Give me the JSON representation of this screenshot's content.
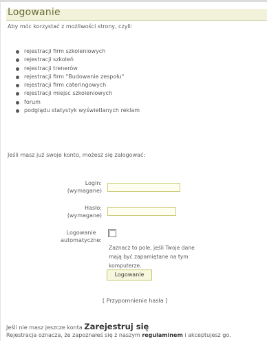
{
  "header": {
    "title": "Logowanie"
  },
  "intro_text": "Aby móc korzystać z możliwości strony, czyli:",
  "features": [
    "rejestracji firm szkoleniowych",
    "rejestracji szkoleń",
    "rejestracji trenerów",
    "rejestracji firm \"Budowanie zespołu\"",
    "rejestracji firm cateringowych",
    "rejestracji miejsc szkoleniowych",
    "forum",
    "podglądu statystyk wyświetlanych reklam"
  ],
  "login_prompt": "Jeśli masz już swoje konto, możesz się zalogować:",
  "form": {
    "login_label": "Login:",
    "login_required": "(wymagane)",
    "login_value": "",
    "password_label": "Hasło:",
    "password_required": "(wymagane)",
    "password_value": "",
    "auto_login_label_line1": "Logowanie",
    "auto_login_label_line2": "automatyczne:",
    "auto_login_hint": "Zaznacz to pole, jeśli Twoje dane mają być zapamiętane na tym komputerze.",
    "submit_label": "Logowanie"
  },
  "password_reminder": {
    "open_bracket": "[ ",
    "link": "Przypomnienie hasła",
    "close_bracket": " ]"
  },
  "register": {
    "prefix": "Jeśli nie masz jeszcze konta ",
    "link": "Zarejestruj się",
    "terms_prefix": "Rejestracja oznacza, że zapoznałeś się z naszym ",
    "terms_link": "regulaminem",
    "terms_suffix": " i akceptujesz go."
  },
  "icons": {
    "bullet": "bullet-icon",
    "checkbox": "checkbox-icon"
  },
  "colors": {
    "title_bar": "#f1f2d9",
    "title_text": "#6b6b3a",
    "input_border": "#c8cc77",
    "text": "#5a5a5a"
  }
}
